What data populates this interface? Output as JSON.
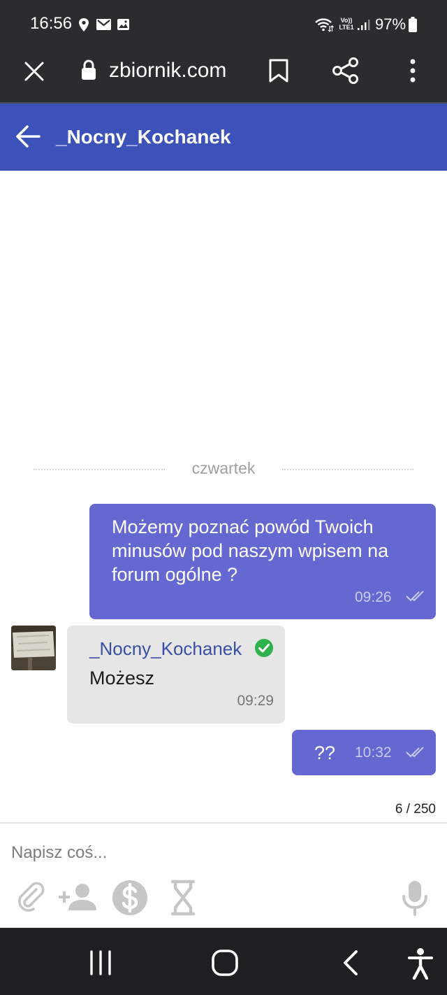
{
  "status_bar": {
    "time": "16:56",
    "battery": "97%",
    "icons": [
      "location-icon",
      "mail-icon",
      "image-icon",
      "wifi-icon",
      "volte-icon",
      "signal-icon",
      "battery-icon"
    ],
    "volte_line1": "Vo))",
    "volte_line2": "LTE1"
  },
  "browser": {
    "url": "zbiornik.com",
    "icons": [
      "close-icon",
      "lock-icon",
      "bookmark-icon",
      "share-icon",
      "more-vert-icon"
    ]
  },
  "header": {
    "title": "_Nocny_Kochanek",
    "back_icon": "arrow-left-icon",
    "color": "#3d52b8"
  },
  "chat": {
    "day_separator": "czwartek",
    "messages": [
      {
        "direction": "outgoing",
        "text": "Możemy poznać powód Twoich minusów pod naszym wpisem na forum ogólne ?",
        "time": "09:26",
        "status": "read"
      },
      {
        "direction": "incoming",
        "sender": "_Nocny_Kochanek",
        "verified": true,
        "text": "Możesz",
        "time": "09:29"
      },
      {
        "direction": "outgoing",
        "text": "??",
        "time": "10:32",
        "status": "read"
      }
    ],
    "outgoing_color": "#6568d0",
    "incoming_color": "#e6e6e6",
    "verified_color": "#2fb14e"
  },
  "composer": {
    "counter": "6 / 250",
    "placeholder": "Napisz coś...",
    "tools": [
      "paperclip-icon",
      "add-person-icon",
      "dollar-icon",
      "hourglass-icon"
    ],
    "mic": "microphone-icon"
  },
  "system_nav": {
    "buttons": [
      "recents-icon",
      "home-icon",
      "back-icon",
      "accessibility-icon"
    ]
  }
}
